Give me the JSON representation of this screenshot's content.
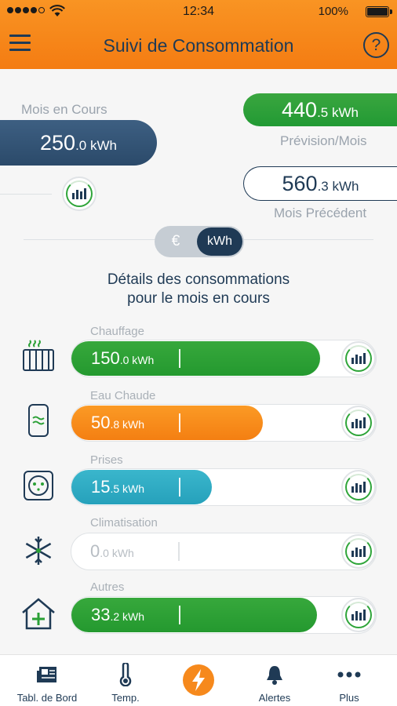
{
  "status_bar": {
    "time": "12:34",
    "battery": "100%"
  },
  "header": {
    "title": "Suivi de Consommation",
    "help": "?"
  },
  "current_month": {
    "label": "Mois en Cours",
    "value_int": "250",
    "value_dec": ".0 kWh"
  },
  "forecast": {
    "label": "Prévision/Mois",
    "value_int": "440",
    "value_dec": ".5 kWh"
  },
  "previous": {
    "label": "Mois Précédent",
    "value_int": "560",
    "value_dec": ".3 kWh"
  },
  "unit_toggle": {
    "euro": "€",
    "kwh": "kWh",
    "selected": "kWh"
  },
  "details": {
    "title_line1": "Détails des consommations",
    "title_line2": "pour le mois en cours"
  },
  "categories": [
    {
      "name": "Chauffage",
      "value_int": "150",
      "value_dec": ".0 kWh",
      "fill_fraction": 0.81,
      "color": "#2aa035",
      "icon": "radiator-icon"
    },
    {
      "name": "Eau Chaude",
      "value_int": "50",
      "value_dec": ".8 kWh",
      "fill_fraction": 0.62,
      "color": "#f7891a",
      "icon": "water-heater-icon"
    },
    {
      "name": "Prises",
      "value_int": "15",
      "value_dec": ".5 kWh",
      "fill_fraction": 0.46,
      "color": "#2eacc4",
      "icon": "power-socket-icon"
    },
    {
      "name": "Climatisation",
      "value_int": "0",
      "value_dec": ".0 kWh",
      "fill_fraction": 0,
      "color": "#ffffff",
      "icon": "snowflake-icon"
    },
    {
      "name": "Autres",
      "value_int": "33",
      "value_dec": ".2 kWh",
      "fill_fraction": 0.8,
      "color": "#2aa035",
      "icon": "house-plus-icon"
    }
  ],
  "bottom_nav": [
    {
      "label": "Tabl. de Bord",
      "icon": "newspaper-icon"
    },
    {
      "label": "Temp.",
      "icon": "thermometer-icon"
    },
    {
      "label": "",
      "icon": "lightning-icon",
      "active": true
    },
    {
      "label": "Alertes",
      "icon": "bell-icon"
    },
    {
      "label": "Plus",
      "icon": "more-dots-icon"
    }
  ],
  "colors": {
    "header": "#f68a1d",
    "navy": "#1f3a55",
    "green": "#2aa035",
    "orange": "#f7891a",
    "teal": "#2eacc4"
  }
}
